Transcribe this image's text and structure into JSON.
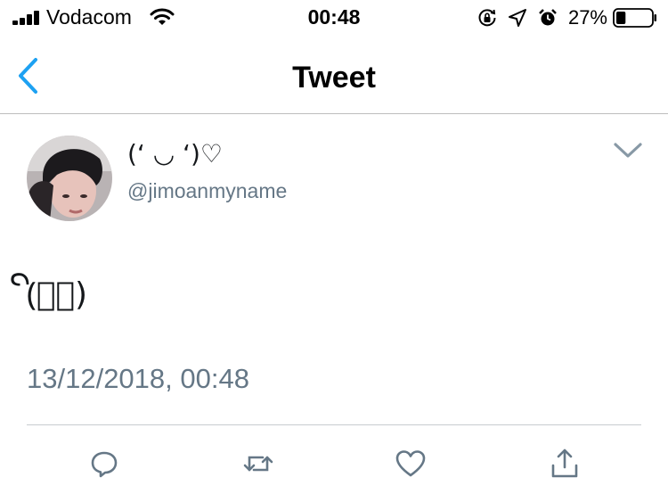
{
  "status_bar": {
    "carrier": "Vodacom",
    "time": "00:48",
    "battery_percent": "27%",
    "battery_level": 0.27,
    "icons": [
      "signal-icon",
      "wifi-icon",
      "orientation-lock-icon",
      "location-icon",
      "alarm-icon",
      "battery-icon"
    ]
  },
  "nav": {
    "title": "Tweet",
    "back_icon": "chevron-left-icon"
  },
  "tweet": {
    "display_name": "(‘ ◡ ‘)♡",
    "handle": "@jimoanmyname",
    "text": "(ꦼ︶ꦼ)",
    "timestamp": "13/12/2018, 00:48",
    "menu_icon": "chevron-down-icon"
  },
  "actions": [
    {
      "name": "reply",
      "icon": "reply-icon"
    },
    {
      "name": "retweet",
      "icon": "retweet-icon"
    },
    {
      "name": "like",
      "icon": "heart-icon"
    },
    {
      "name": "share",
      "icon": "share-icon"
    }
  ],
  "colors": {
    "accent": "#1da1f2",
    "text_primary": "#14171a",
    "text_secondary": "#657786",
    "icon_gray": "#657786",
    "divider": "#c8ccd0"
  }
}
